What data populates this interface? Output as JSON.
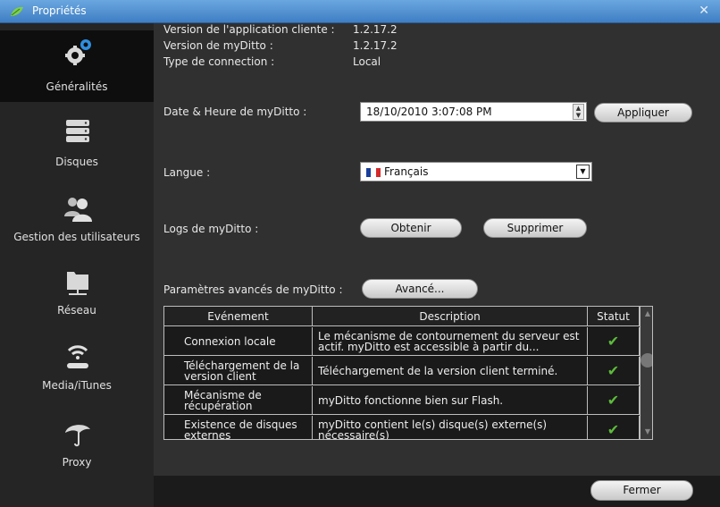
{
  "window": {
    "title": "Propriétés"
  },
  "sidebar": {
    "items": [
      {
        "label": "Généralités",
        "icon": "gears-icon"
      },
      {
        "label": "Disques",
        "icon": "disk-stack-icon"
      },
      {
        "label": "Gestion des utilisateurs",
        "icon": "users-icon"
      },
      {
        "label": "Réseau",
        "icon": "network-folder-icon"
      },
      {
        "label": "Media/iTunes",
        "icon": "wifi-router-icon"
      },
      {
        "label": "Proxy",
        "icon": "umbrella-icon"
      }
    ]
  },
  "general": {
    "client_version_label": "Version de l'application cliente :",
    "client_version": "1.2.17.2",
    "myditto_version_label": "Version de myDitto :",
    "myditto_version": "1.2.17.2",
    "connection_type_label": "Type de connection :",
    "connection_type": "Local",
    "datetime_label": "Date & Heure de myDitto :",
    "datetime_value": "18/10/2010 3:07:08 PM",
    "apply_label": "Appliquer",
    "language_label": "Langue :",
    "language_value": "Français",
    "logs_label": "Logs de myDitto :",
    "get_label": "Obtenir",
    "delete_label": "Supprimer",
    "advanced_label": "Paramètres avancés de myDitto :",
    "advanced_button": "Avancé..."
  },
  "table": {
    "headers": [
      "Evénement",
      "Description",
      "Statut"
    ],
    "rows": [
      {
        "event": "Connexion locale",
        "description": "Le mécanisme de contournement du serveur est actif. myDitto est accessible à partir du...",
        "status": "✔"
      },
      {
        "event": "Téléchargement de la version client",
        "description": "Téléchargement de la version client terminé.",
        "status": "✔"
      },
      {
        "event": "Mécanisme de récupération",
        "description": "myDitto fonctionne bien sur Flash.",
        "status": "✔"
      },
      {
        "event": "Existence de disques externes",
        "description": "myDitto contient le(s) disque(s) externe(s) nécessaire(s)",
        "status": "✔"
      }
    ]
  },
  "footer": {
    "close_label": "Fermer"
  },
  "colors": {
    "titlebar": "#4f8fd0",
    "check": "#5dbb3b",
    "flag_blue": "#1a3f9c",
    "flag_red": "#d42a2a"
  }
}
